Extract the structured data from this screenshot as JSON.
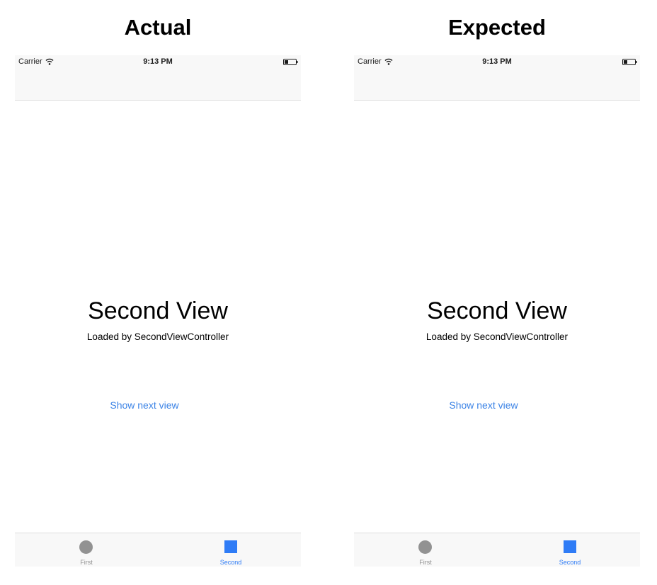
{
  "panels": [
    {
      "heading": "Actual",
      "status_bar": {
        "carrier": "Carrier",
        "time": "9:13 PM",
        "wifi_icon": "wifi-icon",
        "battery_icon": "battery-icon"
      },
      "content": {
        "title": "Second View",
        "subtitle": "Loaded by SecondViewController",
        "link_label": "Show next view"
      },
      "tab_bar": {
        "tabs": [
          {
            "label": "First",
            "icon": "circle-icon",
            "selected": false
          },
          {
            "label": "Second",
            "icon": "square-icon",
            "selected": true
          }
        ]
      }
    },
    {
      "heading": "Expected",
      "status_bar": {
        "carrier": "Carrier",
        "time": "9:13 PM",
        "wifi_icon": "wifi-icon",
        "battery_icon": "battery-icon"
      },
      "content": {
        "title": "Second View",
        "subtitle": "Loaded by SecondViewController",
        "link_label": "Show next view"
      },
      "tab_bar": {
        "tabs": [
          {
            "label": "First",
            "icon": "circle-icon",
            "selected": false
          },
          {
            "label": "Second",
            "icon": "square-icon",
            "selected": true
          }
        ]
      }
    }
  ],
  "colors": {
    "tint": "#2f7cf6",
    "link": "#3d84e6",
    "inactive_tab": "#929292",
    "bar_background": "#f8f8f8"
  }
}
